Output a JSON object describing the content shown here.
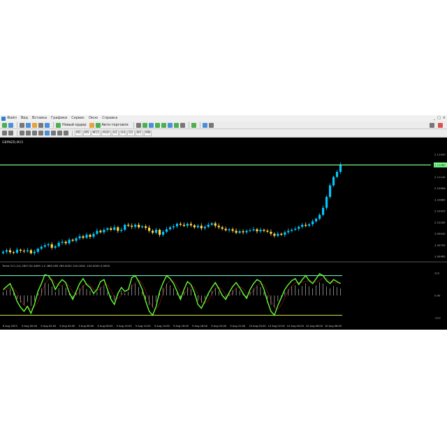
{
  "menu": [
    "Файл",
    "Вид",
    "Вставка",
    "Графики",
    "Сервис",
    "Окно",
    "Справка"
  ],
  "toolbar": {
    "new_order_label": "Новый ордер",
    "auto_trading_label": "Авто-торговля",
    "timeframes": [
      "M1",
      "M5",
      "M15",
      "M30",
      "H1",
      "H4",
      "D1",
      "W1",
      "MN"
    ]
  },
  "window_controls": [
    "_",
    "□",
    "×"
  ],
  "chart_window": {
    "title": "GBPNZD,M15",
    "indicator_label": "Trend CCI (14) 2837 82.4899 1.0 -889.285 285.0000 100.0000 -100.0000 0.0000"
  },
  "price_axis": {
    "ticks": [
      "2.11420",
      "2.11385",
      "2.11145",
      "2.10906",
      "2.10665",
      "2.10425",
      "2.10185",
      "2.09945",
      "2.09705",
      "2.09465"
    ],
    "current_price": "2.11260"
  },
  "indicator_axis": {
    "ticks": [
      "210",
      "0.00",
      "-210"
    ]
  },
  "time_axis": [
    "8 Aug 2023",
    "9 Aug 00:00",
    "9 Aug 02:00",
    "9 Aug 04:00",
    "9 Aug 06:00",
    "9 Aug 08:00",
    "9 Aug 10:00",
    "9 Aug 12:00",
    "9 Aug 14:00",
    "9 Aug 16:00",
    "9 Aug 18:00",
    "9 Aug 20:00",
    "9 Aug 22:00",
    "10 Aug 00:00",
    "10 Aug 02:00",
    "10 Aug 04:00",
    "10 Aug 06:00",
    "10 Aug 08:00"
  ],
  "colors": {
    "bull": "#00c8ff",
    "bear": "#ffd84a",
    "price_line": "#7cfc8a",
    "cci": "#66ff33",
    "signal": "#ff3030",
    "level": "#7fffd4",
    "level_low": "#d4e84a"
  },
  "chart_data": {
    "type": "candlestick",
    "price_ylim": [
      2.094,
      2.115
    ],
    "current_price": 2.1126,
    "close_path": [
      2.0952,
      2.0955,
      2.0951,
      2.095,
      2.0956,
      2.0954,
      2.0953,
      2.0955,
      2.0949,
      2.0952,
      2.0958,
      2.0962,
      2.0965,
      2.0967,
      2.096,
      2.0963,
      2.097,
      2.0972,
      2.0969,
      2.0976,
      2.0974,
      2.0979,
      2.0983,
      2.098,
      2.0986,
      2.0982,
      2.0988,
      2.0994,
      2.0991,
      2.0996,
      2.0999,
      2.0996,
      2.1001,
      2.0994,
      2.0996,
      2.1006,
      2.1004,
      2.1002,
      2.1006,
      2.1001,
      2.1003,
      2.1,
      2.0994,
      2.099,
      2.0996,
      2.0986,
      2.0992,
      2.0997,
      2.1001,
      2.1003,
      2.1008,
      2.1006,
      2.1004,
      2.1008,
      2.1005,
      2.1001,
      2.1004,
      2.0999,
      2.1002,
      2.1006,
      2.1009,
      2.1004,
      2.1001,
      2.0998,
      2.0995,
      2.0997,
      2.0994,
      2.099,
      2.0993,
      2.0991,
      2.0994,
      2.0995,
      2.0997,
      2.0993,
      2.0996,
      2.0994,
      2.0992,
      2.0988,
      2.0984,
      2.0988,
      2.0986,
      2.0991,
      2.0994,
      2.0996,
      2.0998,
      2.1002,
      2.1006,
      2.1004,
      2.1007,
      2.1013,
      2.1018,
      2.1026,
      2.104,
      2.1062,
      2.1085,
      2.1102,
      2.1112,
      2.1126
    ],
    "cci": [
      60,
      90,
      120,
      40,
      -60,
      -120,
      -160,
      -110,
      -180,
      -90,
      40,
      120,
      210,
      200,
      150,
      60,
      120,
      160,
      130,
      30,
      -40,
      40,
      120,
      170,
      110,
      80,
      20,
      60,
      140,
      160,
      60,
      -40,
      -90,
      20,
      80,
      40,
      60,
      180,
      200,
      140,
      60,
      -60,
      -160,
      -200,
      -110,
      40,
      130,
      200,
      170,
      120,
      40,
      -40,
      60,
      140,
      110,
      30,
      -90,
      -130,
      -60,
      20,
      80,
      130,
      70,
      0,
      -40,
      30,
      90,
      130,
      80,
      20,
      -30,
      60,
      120,
      160,
      140,
      60,
      -60,
      -160,
      -200,
      -100,
      -20,
      60,
      110,
      150,
      170,
      110,
      160,
      200,
      150,
      120,
      170,
      220,
      200,
      150,
      120,
      160,
      140,
      120
    ]
  }
}
